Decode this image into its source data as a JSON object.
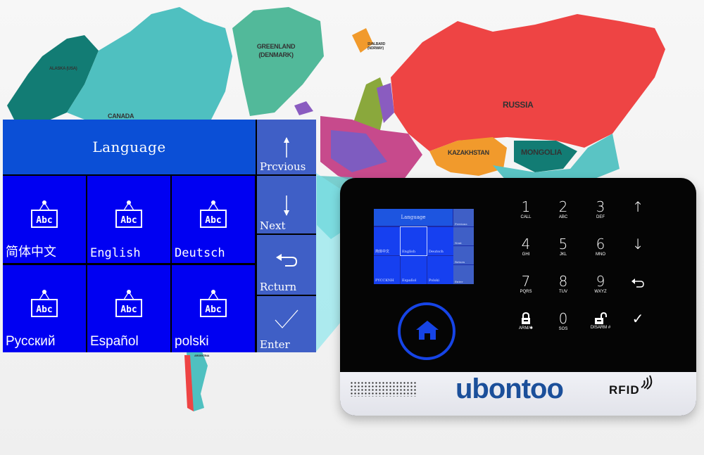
{
  "map": {
    "labels": [
      "ALASKA (USA)",
      "CANADA",
      "GREENLAND (DENMARK)",
      "SVALBARD (NORWAY)",
      "RUSSIA",
      "KAZAKHSTAN",
      "MONGOLIA",
      "ARGENTINA"
    ],
    "colors": {
      "russia": "#ee4444",
      "greenland": "#52b99a",
      "canada": "#4fc0c0",
      "alaska": "#127c74",
      "kazakhstan": "#f19a2c",
      "mongolia": "#127c74",
      "china": "#5ac4c4"
    }
  },
  "panel": {
    "title": "Language",
    "languages": [
      {
        "label": "简体中文",
        "icon": "sign-abc-icon"
      },
      {
        "label": "English",
        "icon": "sign-abc-icon"
      },
      {
        "label": "Deutsch",
        "icon": "sign-abc-icon"
      },
      {
        "label": "Русский",
        "icon": "sign-abc-icon"
      },
      {
        "label": "Español",
        "icon": "sign-abc-icon"
      },
      {
        "label": "polski",
        "icon": "sign-abc-icon"
      }
    ],
    "icon_text": "Abc",
    "side_buttons": [
      {
        "label": "Prcvious",
        "icon": "arrow-up-icon"
      },
      {
        "label": "Next",
        "icon": "arrow-down-icon"
      },
      {
        "label": "Rcturn",
        "icon": "return-icon"
      },
      {
        "label": "Enter",
        "icon": "check-icon"
      }
    ],
    "colors": {
      "title": "#0b4fd6",
      "cell": "#0000f2",
      "side": "#3f5fc6"
    }
  },
  "device": {
    "brand": "ubontoo",
    "rfid": "RFID",
    "mini_screen": {
      "title": "Language",
      "languages": [
        "简体中文",
        "English",
        "Deutsch",
        "PYCCKNH",
        "Español",
        "Polski"
      ],
      "side": [
        "Previous",
        "Next",
        "Return",
        "Enter"
      ]
    },
    "keypad": [
      {
        "digit": "1",
        "sub": "CALL"
      },
      {
        "digit": "2",
        "sub": "ABC"
      },
      {
        "digit": "3",
        "sub": "DEF"
      },
      {
        "digit": "↑",
        "sub": ""
      },
      {
        "digit": "4",
        "sub": "GHI"
      },
      {
        "digit": "5",
        "sub": "JKL"
      },
      {
        "digit": "6",
        "sub": "MNO"
      },
      {
        "digit": "↓",
        "sub": ""
      },
      {
        "digit": "7",
        "sub": "PQRS"
      },
      {
        "digit": "8",
        "sub": "TUV"
      },
      {
        "digit": "9",
        "sub": "WXYZ"
      },
      {
        "digit": "⮌",
        "sub": ""
      },
      {
        "digit": "",
        "sub": "ARM/✱"
      },
      {
        "digit": "0",
        "sub": "SOS"
      },
      {
        "digit": "",
        "sub": "DISARM #"
      },
      {
        "digit": "✓",
        "sub": ""
      }
    ],
    "home_icon": "home-icon"
  }
}
